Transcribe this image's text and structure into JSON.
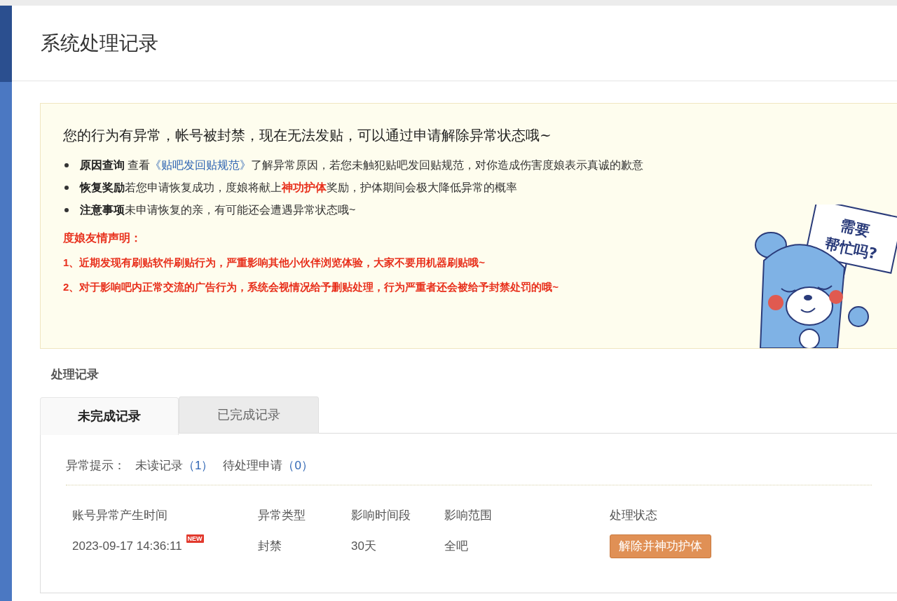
{
  "page_title": "系统处理记录",
  "notice": {
    "headline": "您的行为有异常，帐号被封禁，现在无法发贴，可以通过申请解除异常状态哦~",
    "items": [
      {
        "segments": [
          {
            "kind": "bold",
            "text": "原因查询"
          },
          {
            "kind": "plain",
            "text": " 查看"
          },
          {
            "kind": "link",
            "text": "《贴吧发回贴规范》"
          },
          {
            "kind": "plain",
            "text": "了解异常原因，若您未触犯贴吧发回贴规范，对你造成伤害度娘表示真诚的歉意"
          }
        ]
      },
      {
        "segments": [
          {
            "kind": "bold",
            "text": "恢复奖励"
          },
          {
            "kind": "plain",
            "text": "若您申请恢复成功，度娘将献上"
          },
          {
            "kind": "highlight",
            "text": "神功护体"
          },
          {
            "kind": "plain",
            "text": "奖励，护体期间会极大降低异常的概率"
          }
        ]
      },
      {
        "segments": [
          {
            "kind": "bold",
            "text": "注意事项"
          },
          {
            "kind": "plain",
            "text": "未申请恢复的亲，有可能还会遭遇异常状态哦~"
          }
        ]
      }
    ],
    "statement_title": "度娘友情声明：",
    "statements": [
      "1、近期发现有刷贴软件刷贴行为，严重影响其他小伙伴浏览体验，大家不要用机器刷贴哦~",
      "2、对于影响吧内正常交流的广告行为，系统会视情况给予删贴处理，行为严重者还会被给予封禁处罚的哦~"
    ],
    "mascot_sign": [
      "需要",
      "帮忙吗?"
    ]
  },
  "records": {
    "title": "处理记录",
    "tabs": [
      {
        "label": "未完成记录",
        "selected": true
      },
      {
        "label": "已完成记录",
        "selected": false
      }
    ],
    "hint": {
      "label": "异常提示：",
      "counters": [
        {
          "label": "未读记录",
          "count": "（1）"
        },
        {
          "label": "待处理申请",
          "count": "（0）"
        }
      ]
    },
    "table": {
      "columns": [
        "账号异常产生时间",
        "异常类型",
        "影响时间段",
        "影响范围",
        "处理状态"
      ],
      "rows": [
        {
          "time": "2023-09-17 14:36:11",
          "new_badge": "NEW",
          "type": "封禁",
          "duration": "30天",
          "scope": "全吧",
          "action": "解除并神功护体"
        }
      ]
    }
  }
}
